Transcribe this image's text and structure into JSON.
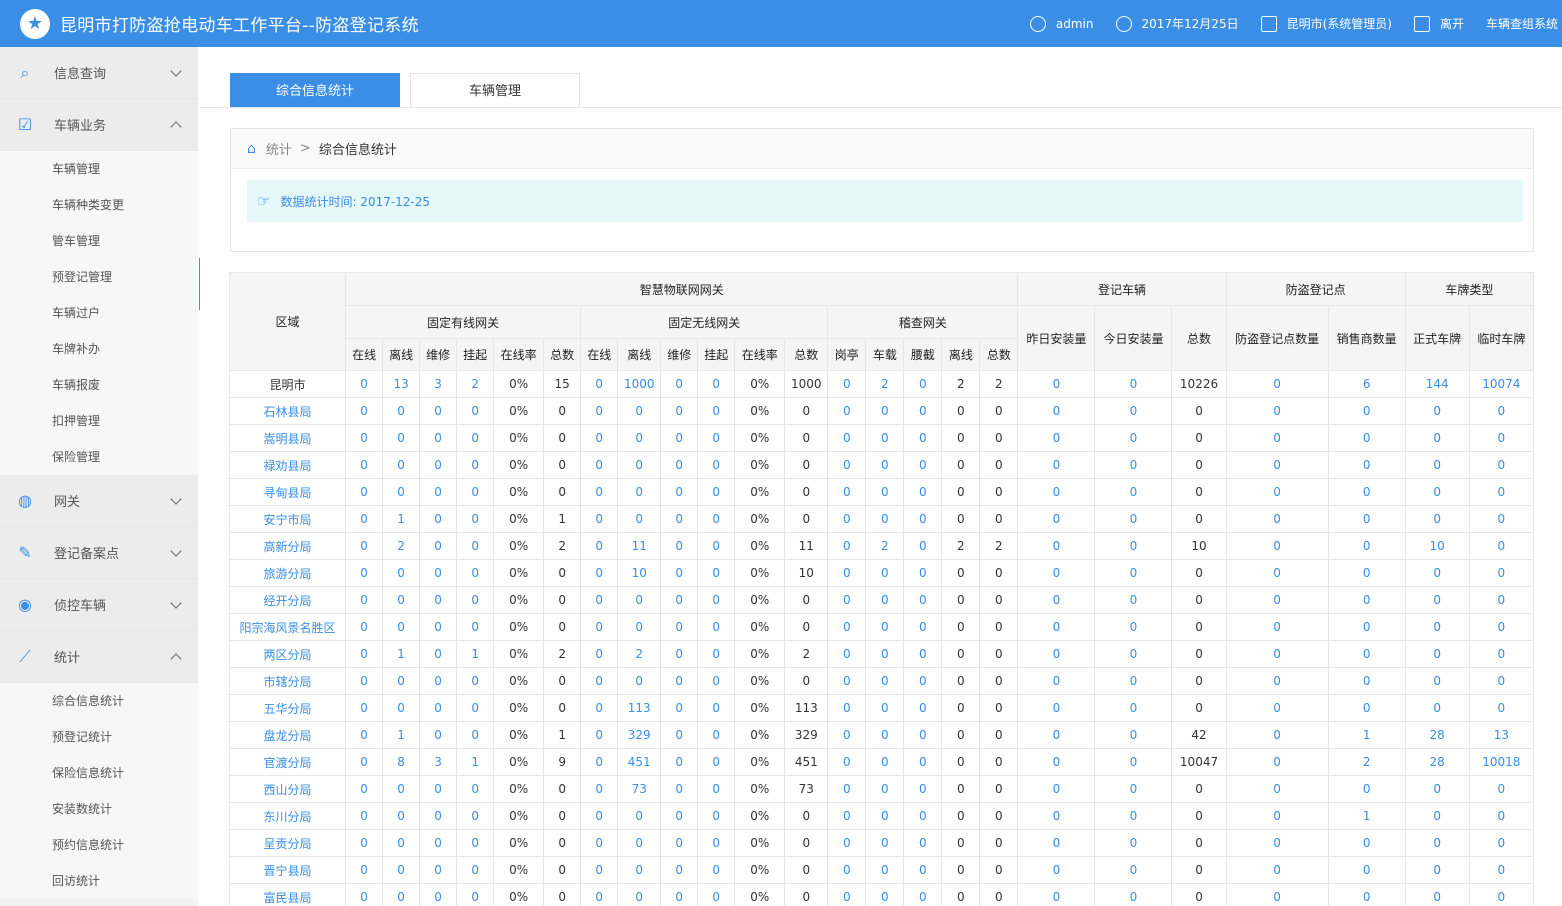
{
  "app": {
    "title": "昆明市打防盗抢电动车工作平台--防盗登记系统",
    "logo_icon": "star-badge-icon"
  },
  "header": {
    "user": "admin",
    "date": "2017年12月25日",
    "location": "昆明市(系统管理员)",
    "logout": "离开",
    "right_link": "车辆查组系统"
  },
  "sidebar": {
    "groups": [
      {
        "label": "信息查询",
        "icon": "search-doc-icon",
        "expanded": false
      },
      {
        "label": "车辆业务",
        "icon": "checkbox-icon",
        "expanded": true,
        "items": [
          "车辆管理",
          "车辆种类变更",
          "管车管理",
          "预登记管理",
          "车辆过户",
          "车牌补办",
          "车辆报废",
          "扣押管理",
          "保险管理"
        ]
      },
      {
        "label": "网关",
        "icon": "globe-icon",
        "expanded": false
      },
      {
        "label": "登记备案点",
        "icon": "edit-doc-icon",
        "expanded": false
      },
      {
        "label": "侦控车辆",
        "icon": "location-pin-icon",
        "expanded": false
      },
      {
        "label": "统计",
        "icon": "line-chart-icon",
        "expanded": true,
        "items": [
          "综合信息统计",
          "预登记统计",
          "保险信息统计",
          "安装数统计",
          "预约信息统计",
          "回访统计"
        ]
      }
    ]
  },
  "tabs": [
    "综合信息统计",
    "车辆管理"
  ],
  "breadcrumb": {
    "parent": "统计",
    "separator": ">",
    "current": "综合信息统计"
  },
  "notice": "数据统计时间: 2017-12-25",
  "table": {
    "h_region": "区域",
    "h_iot": "智慧物联网网关",
    "h_reg_vehicle": "登记车辆",
    "h_antitheft": "防盗登记点",
    "h_plate": "车牌类型",
    "h_fixed_wired": "固定有线网关",
    "h_fixed_wireless": "固定无线网关",
    "h_inspection": "稽查网关",
    "h_yesterday": "昨日安装量",
    "h_today": "今日安装量",
    "h_total": "总数",
    "h_points": "防盗登记点数量",
    "h_sellers": "销售商数量",
    "h_formal": "正式车牌",
    "h_temp": "临时车牌",
    "sub_wired": [
      "在线",
      "离线",
      "维修",
      "挂起",
      "在线率",
      "总数"
    ],
    "sub_wireless": [
      "在线",
      "离线",
      "维修",
      "挂起",
      "在线率",
      "总数"
    ],
    "sub_inspection": [
      "岗亭",
      "车载",
      "腰截",
      "离线",
      "总数"
    ],
    "rows": [
      [
        "昆明市",
        "0",
        "13",
        "3",
        "2",
        "0%",
        "15",
        "0",
        "1000",
        "0",
        "0",
        "0%",
        "1000",
        "0",
        "2",
        "0",
        "2",
        "2",
        "0",
        "0",
        "10226",
        "0",
        "6",
        "144",
        "10074"
      ],
      [
        "石林县局",
        "0",
        "0",
        "0",
        "0",
        "0%",
        "0",
        "0",
        "0",
        "0",
        "0",
        "0%",
        "0",
        "0",
        "0",
        "0",
        "0",
        "0",
        "0",
        "0",
        "0",
        "0",
        "0",
        "0",
        "0"
      ],
      [
        "嵩明县局",
        "0",
        "0",
        "0",
        "0",
        "0%",
        "0",
        "0",
        "0",
        "0",
        "0",
        "0%",
        "0",
        "0",
        "0",
        "0",
        "0",
        "0",
        "0",
        "0",
        "0",
        "0",
        "0",
        "0",
        "0"
      ],
      [
        "禄劝县局",
        "0",
        "0",
        "0",
        "0",
        "0%",
        "0",
        "0",
        "0",
        "0",
        "0",
        "0%",
        "0",
        "0",
        "0",
        "0",
        "0",
        "0",
        "0",
        "0",
        "0",
        "0",
        "0",
        "0",
        "0"
      ],
      [
        "寻甸县局",
        "0",
        "0",
        "0",
        "0",
        "0%",
        "0",
        "0",
        "0",
        "0",
        "0",
        "0%",
        "0",
        "0",
        "0",
        "0",
        "0",
        "0",
        "0",
        "0",
        "0",
        "0",
        "0",
        "0",
        "0"
      ],
      [
        "安宁市局",
        "0",
        "1",
        "0",
        "0",
        "0%",
        "1",
        "0",
        "0",
        "0",
        "0",
        "0%",
        "0",
        "0",
        "0",
        "0",
        "0",
        "0",
        "0",
        "0",
        "0",
        "0",
        "0",
        "0",
        "0"
      ],
      [
        "高新分局",
        "0",
        "2",
        "0",
        "0",
        "0%",
        "2",
        "0",
        "11",
        "0",
        "0",
        "0%",
        "11",
        "0",
        "2",
        "0",
        "2",
        "2",
        "0",
        "0",
        "10",
        "0",
        "0",
        "10",
        "0"
      ],
      [
        "旅游分局",
        "0",
        "0",
        "0",
        "0",
        "0%",
        "0",
        "0",
        "10",
        "0",
        "0",
        "0%",
        "10",
        "0",
        "0",
        "0",
        "0",
        "0",
        "0",
        "0",
        "0",
        "0",
        "0",
        "0",
        "0"
      ],
      [
        "经开分局",
        "0",
        "0",
        "0",
        "0",
        "0%",
        "0",
        "0",
        "0",
        "0",
        "0",
        "0%",
        "0",
        "0",
        "0",
        "0",
        "0",
        "0",
        "0",
        "0",
        "0",
        "0",
        "0",
        "0",
        "0"
      ],
      [
        "阳宗海风景名胜区",
        "0",
        "0",
        "0",
        "0",
        "0%",
        "0",
        "0",
        "0",
        "0",
        "0",
        "0%",
        "0",
        "0",
        "0",
        "0",
        "0",
        "0",
        "0",
        "0",
        "0",
        "0",
        "0",
        "0",
        "0"
      ],
      [
        "两区分局",
        "0",
        "1",
        "0",
        "1",
        "0%",
        "2",
        "0",
        "2",
        "0",
        "0",
        "0%",
        "2",
        "0",
        "0",
        "0",
        "0",
        "0",
        "0",
        "0",
        "0",
        "0",
        "0",
        "0",
        "0"
      ],
      [
        "市辖分局",
        "0",
        "0",
        "0",
        "0",
        "0%",
        "0",
        "0",
        "0",
        "0",
        "0",
        "0%",
        "0",
        "0",
        "0",
        "0",
        "0",
        "0",
        "0",
        "0",
        "0",
        "0",
        "0",
        "0",
        "0"
      ],
      [
        "五华分局",
        "0",
        "0",
        "0",
        "0",
        "0%",
        "0",
        "0",
        "113",
        "0",
        "0",
        "0%",
        "113",
        "0",
        "0",
        "0",
        "0",
        "0",
        "0",
        "0",
        "0",
        "0",
        "0",
        "0",
        "0"
      ],
      [
        "盘龙分局",
        "0",
        "1",
        "0",
        "0",
        "0%",
        "1",
        "0",
        "329",
        "0",
        "0",
        "0%",
        "329",
        "0",
        "0",
        "0",
        "0",
        "0",
        "0",
        "0",
        "42",
        "0",
        "1",
        "28",
        "13"
      ],
      [
        "官渡分局",
        "0",
        "8",
        "3",
        "1",
        "0%",
        "9",
        "0",
        "451",
        "0",
        "0",
        "0%",
        "451",
        "0",
        "0",
        "0",
        "0",
        "0",
        "0",
        "0",
        "10047",
        "0",
        "2",
        "28",
        "10018"
      ],
      [
        "西山分局",
        "0",
        "0",
        "0",
        "0",
        "0%",
        "0",
        "0",
        "73",
        "0",
        "0",
        "0%",
        "73",
        "0",
        "0",
        "0",
        "0",
        "0",
        "0",
        "0",
        "0",
        "0",
        "0",
        "0",
        "0"
      ],
      [
        "东川分局",
        "0",
        "0",
        "0",
        "0",
        "0%",
        "0",
        "0",
        "0",
        "0",
        "0",
        "0%",
        "0",
        "0",
        "0",
        "0",
        "0",
        "0",
        "0",
        "0",
        "0",
        "0",
        "1",
        "0",
        "0"
      ],
      [
        "呈贡分局",
        "0",
        "0",
        "0",
        "0",
        "0%",
        "0",
        "0",
        "0",
        "0",
        "0",
        "0%",
        "0",
        "0",
        "0",
        "0",
        "0",
        "0",
        "0",
        "0",
        "0",
        "0",
        "0",
        "0",
        "0"
      ],
      [
        "晋宁县局",
        "0",
        "0",
        "0",
        "0",
        "0%",
        "0",
        "0",
        "0",
        "0",
        "0",
        "0%",
        "0",
        "0",
        "0",
        "0",
        "0",
        "0",
        "0",
        "0",
        "0",
        "0",
        "0",
        "0",
        "0"
      ],
      [
        "富民县局",
        "0",
        "0",
        "0",
        "0",
        "0%",
        "0",
        "0",
        "0",
        "0",
        "0",
        "0%",
        "0",
        "0",
        "0",
        "0",
        "0",
        "0",
        "0",
        "0",
        "0",
        "0",
        "0",
        "0",
        "0"
      ]
    ]
  }
}
